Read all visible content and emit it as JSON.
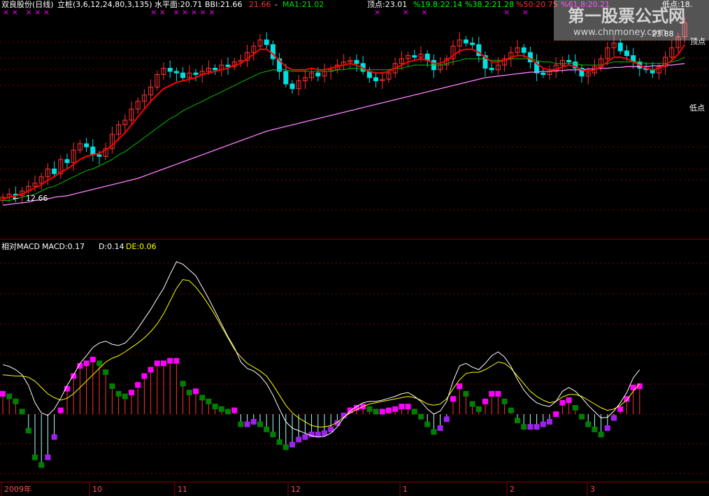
{
  "header": {
    "title": "双良股份(日线)",
    "indicator": "立桩(3,6,12,24,80,3,135)",
    "level_label": "水平面:20.71",
    "bbi_label": "BBI:21.66",
    "bbi_value": "21.66",
    "dash": "-",
    "ma1_label": "MA1:21.02",
    "peak_label": "顶点:23.01",
    "fib_19": "%19.8:22.14",
    "fib_38": "%38.2:21.28",
    "fib_50": "%50:20.75",
    "fib_61": "%61.8:20.21",
    "low_label": "低点:18."
  },
  "annotations": {
    "high_price": "23.88",
    "low_price": "12.66",
    "low_arrow": "←",
    "top_point": "顶点",
    "bottom_point": "低点"
  },
  "macd_header": {
    "name": "相对MACD",
    "macd": "MACD:0.17",
    "d": "D:0.14",
    "de": "DE:0.06"
  },
  "time_axis": [
    "2009年",
    "10",
    "11",
    "12",
    "1",
    "2",
    "3"
  ],
  "watermark": {
    "title": "第一股票公式网",
    "url": "www.chnmoney.com"
  },
  "colors": {
    "up": "#ff3232",
    "down": "#00e0e0",
    "ma_red": "#ff0000",
    "ma_yellow": "#ffff00",
    "ma_green": "#00c000",
    "ma_pink": "#ff80ff",
    "hist_pos": "#ff3232",
    "hist_neg": "#aaffff",
    "block_pos": "#ff00ff",
    "block_neg": "#a020f0",
    "block_green": "#007f00",
    "dif": "#ffffff",
    "dea": "#ffff00"
  },
  "chart_data": [
    {
      "type": "candlestick",
      "title": "双良股份(日线)",
      "ylim": [
        12,
        24
      ],
      "close": [
        12.8,
        13.0,
        12.9,
        13.2,
        13.5,
        13.7,
        14.1,
        14.6,
        14.3,
        15.2,
        15.0,
        15.8,
        16.2,
        16.0,
        15.5,
        15.4,
        15.9,
        16.8,
        17.4,
        17.7,
        18.4,
        18.9,
        19.3,
        19.8,
        20.6,
        21.0,
        20.8,
        20.7,
        20.4,
        20.7,
        20.6,
        20.8,
        21.0,
        20.9,
        21.2,
        21.1,
        21.4,
        21.5,
        22.0,
        22.4,
        22.8,
        22.5,
        21.6,
        20.8,
        20.0,
        19.7,
        20.2,
        20.4,
        20.7,
        20.5,
        20.8,
        20.9,
        21.2,
        21.4,
        21.5,
        21.3,
        20.8,
        20.4,
        20.2,
        20.3,
        20.7,
        21.3,
        21.6,
        21.8,
        21.7,
        21.9,
        21.5,
        20.9,
        21.2,
        21.6,
        22.4,
        22.8,
        22.6,
        22.5,
        21.8,
        21.0,
        20.9,
        21.2,
        21.6,
        22.0,
        22.3,
        22.0,
        21.4,
        20.7,
        20.6,
        20.8,
        21.2,
        21.5,
        21.4,
        21.0,
        20.5,
        20.7,
        21.1,
        21.6,
        22.3,
        22.6,
        22.1,
        21.8,
        21.4,
        21.0,
        20.9,
        20.7,
        21.1,
        21.7,
        22.3,
        23.0,
        23.88
      ],
      "ma_red": [
        12.7,
        12.8,
        12.9,
        13.0,
        13.2,
        13.4,
        13.6,
        13.9,
        14.1,
        14.4,
        14.6,
        14.9,
        15.2,
        15.4,
        15.5,
        15.6,
        15.8,
        16.1,
        16.5,
        16.9,
        17.4,
        17.9,
        18.4,
        18.9,
        19.3,
        19.7,
        19.9,
        20.1,
        20.2,
        20.3,
        20.4,
        20.6,
        20.7,
        20.8,
        20.9,
        21.0,
        21.2,
        21.3,
        21.6,
        21.9,
        22.2,
        22.2,
        21.9,
        21.5,
        21.1,
        20.9,
        20.9,
        20.9,
        21.0,
        20.9,
        20.9,
        21.0,
        21.1,
        21.2,
        21.3,
        21.2,
        21.0,
        20.8,
        20.7,
        20.7,
        20.8,
        21.0,
        21.2,
        21.4,
        21.5,
        21.6,
        21.5,
        21.3,
        21.3,
        21.5,
        21.8,
        22.1,
        22.2,
        22.2,
        22.0,
        21.7,
        21.4,
        21.4,
        21.5,
        21.7,
        21.8,
        21.8,
        21.6,
        21.3,
        21.0,
        20.9,
        20.9,
        21.1,
        21.2,
        21.1,
        20.9,
        20.8,
        20.9,
        21.1,
        21.4,
        21.7,
        21.7,
        21.6,
        21.4,
        21.2,
        21.0,
        20.9,
        21.0,
        21.2,
        21.5,
        21.9,
        22.5
      ],
      "ma_green": [
        12.6,
        12.6,
        12.7,
        12.8,
        12.9,
        13.0,
        13.2,
        13.4,
        13.5,
        13.7,
        13.9,
        14.1,
        14.3,
        14.5,
        14.6,
        14.8,
        15.0,
        15.2,
        15.5,
        15.7,
        16.0,
        16.3,
        16.6,
        16.9,
        17.2,
        17.5,
        17.8,
        18.0,
        18.3,
        18.5,
        18.7,
        18.9,
        19.1,
        19.3,
        19.5,
        19.7,
        19.9,
        20.1,
        20.3,
        20.5,
        20.7,
        20.8,
        20.9,
        20.9,
        20.9,
        20.8,
        20.8,
        20.8,
        20.8,
        20.8,
        20.8,
        20.8,
        20.9,
        20.9,
        21.0,
        21.0,
        20.9,
        20.9,
        20.9,
        20.9,
        20.9,
        21.0,
        21.0,
        21.1,
        21.2,
        21.2,
        21.2,
        21.2,
        21.2,
        21.3,
        21.4,
        21.5,
        21.6,
        21.6,
        21.6,
        21.6,
        21.5,
        21.5,
        21.5,
        21.6,
        21.6,
        21.6,
        21.6,
        21.5,
        21.4,
        21.4,
        21.3,
        21.3,
        21.3,
        21.3,
        21.2,
        21.2,
        21.2,
        21.2,
        21.3,
        21.4,
        21.4,
        21.4,
        21.4,
        21.4,
        21.3,
        21.3,
        21.3,
        21.3,
        21.4,
        21.5,
        21.7
      ],
      "ma_pink": [
        12.3,
        12.35,
        12.4,
        12.45,
        12.5,
        12.6,
        12.65,
        12.7,
        12.8,
        12.85,
        12.9,
        13.0,
        13.1,
        13.2,
        13.3,
        13.4,
        13.5,
        13.6,
        13.7,
        13.8,
        13.9,
        14.0,
        14.15,
        14.3,
        14.45,
        14.6,
        14.75,
        14.9,
        15.05,
        15.2,
        15.35,
        15.5,
        15.65,
        15.8,
        15.95,
        16.1,
        16.25,
        16.4,
        16.55,
        16.7,
        16.85,
        17.0,
        17.1,
        17.2,
        17.3,
        17.4,
        17.5,
        17.6,
        17.7,
        17.8,
        17.9,
        18.0,
        18.1,
        18.2,
        18.3,
        18.4,
        18.5,
        18.6,
        18.7,
        18.8,
        18.9,
        19.0,
        19.1,
        19.2,
        19.3,
        19.4,
        19.5,
        19.6,
        19.7,
        19.8,
        19.9,
        20.0,
        20.1,
        20.2,
        20.3,
        20.4,
        20.45,
        20.5,
        20.55,
        20.6,
        20.65,
        20.7,
        20.75,
        20.75,
        20.8,
        20.8,
        20.85,
        20.85,
        20.9,
        20.9,
        20.9,
        20.95,
        20.95,
        21.0,
        21.0,
        21.05,
        21.05,
        21.1,
        21.1,
        21.1,
        21.1,
        21.15,
        21.15,
        21.2,
        21.2,
        21.25,
        21.3
      ]
    },
    {
      "type": "bar",
      "title": "相对MACD",
      "ylim": [
        -1.1,
        2.5
      ],
      "dif": [
        0.78,
        0.75,
        0.7,
        0.62,
        0.45,
        0.18,
        0.02,
        -0.02,
        0.08,
        0.25,
        0.45,
        0.62,
        0.8,
        0.92,
        1.05,
        1.12,
        1.15,
        1.1,
        1.08,
        1.12,
        1.22,
        1.35,
        1.5,
        1.65,
        1.82,
        1.98,
        2.2,
        2.4,
        2.36,
        2.27,
        2.18,
        2.0,
        1.82,
        1.62,
        1.42,
        1.22,
        1.05,
        0.82,
        0.72,
        0.68,
        0.6,
        0.48,
        0.3,
        0.08,
        -0.12,
        -0.22,
        -0.26,
        -0.3,
        -0.34,
        -0.36,
        -0.35,
        -0.3,
        -0.2,
        -0.06,
        0.05,
        0.12,
        0.18,
        0.2,
        0.2,
        0.22,
        0.25,
        0.28,
        0.32,
        0.34,
        0.28,
        0.2,
        0.08,
        0.0,
        0.05,
        0.2,
        0.52,
        0.76,
        0.8,
        0.74,
        0.7,
        0.8,
        0.92,
        0.98,
        0.9,
        0.75,
        0.55,
        0.38,
        0.26,
        0.18,
        0.14,
        0.12,
        0.2,
        0.36,
        0.42,
        0.36,
        0.26,
        0.14,
        0.04,
        -0.06,
        -0.05,
        0.05,
        0.18,
        0.34,
        0.57,
        0.7
      ],
      "dea": [
        0.62,
        0.61,
        0.6,
        0.6,
        0.58,
        0.52,
        0.42,
        0.32,
        0.26,
        0.22,
        0.25,
        0.32,
        0.42,
        0.52,
        0.62,
        0.72,
        0.82,
        0.88,
        0.92,
        0.98,
        1.05,
        1.12,
        1.2,
        1.3,
        1.42,
        1.58,
        1.78,
        1.98,
        2.12,
        2.1,
        2.0,
        1.87,
        1.72,
        1.56,
        1.38,
        1.2,
        1.02,
        0.9,
        0.8,
        0.74,
        0.68,
        0.6,
        0.46,
        0.3,
        0.14,
        0.02,
        -0.06,
        -0.12,
        -0.18,
        -0.2,
        -0.2,
        -0.18,
        -0.13,
        -0.05,
        0.02,
        0.07,
        0.12,
        0.16,
        0.18,
        0.2,
        0.22,
        0.24,
        0.26,
        0.28,
        0.26,
        0.22,
        0.16,
        0.14,
        0.16,
        0.24,
        0.4,
        0.54,
        0.64,
        0.66,
        0.66,
        0.7,
        0.76,
        0.82,
        0.8,
        0.72,
        0.6,
        0.48,
        0.36,
        0.28,
        0.22,
        0.18,
        0.2,
        0.27,
        0.31,
        0.31,
        0.28,
        0.22,
        0.16,
        0.1,
        0.06,
        0.08,
        0.14,
        0.22,
        0.36,
        0.48
      ],
      "macd": [
        0.32,
        0.28,
        0.2,
        0.04,
        -0.26,
        -0.68,
        -0.8,
        -0.68,
        -0.36,
        0.06,
        0.4,
        0.6,
        0.76,
        0.8,
        0.86,
        0.8,
        0.66,
        0.44,
        0.32,
        0.28,
        0.34,
        0.46,
        0.6,
        0.7,
        0.8,
        0.8,
        0.84,
        0.84,
        0.48,
        0.34,
        0.36,
        0.26,
        0.2,
        0.12,
        0.08,
        0.04,
        0.06,
        -0.16,
        -0.16,
        -0.12,
        -0.16,
        -0.24,
        -0.32,
        -0.44,
        -0.52,
        -0.48,
        -0.4,
        -0.36,
        -0.32,
        -0.32,
        -0.3,
        -0.24,
        -0.14,
        -0.02,
        0.06,
        0.1,
        0.12,
        0.08,
        0.04,
        0.04,
        0.06,
        0.08,
        0.12,
        0.12,
        0.04,
        -0.04,
        -0.16,
        -0.28,
        -0.22,
        -0.08,
        0.24,
        0.44,
        0.32,
        0.16,
        0.08,
        0.2,
        0.32,
        0.32,
        0.2,
        0.06,
        -0.1,
        -0.2,
        -0.2,
        -0.2,
        -0.16,
        -0.12,
        0.0,
        0.18,
        0.22,
        0.1,
        -0.04,
        -0.16,
        -0.24,
        -0.32,
        -0.22,
        -0.06,
        0.08,
        0.24,
        0.42,
        0.44
      ]
    }
  ]
}
